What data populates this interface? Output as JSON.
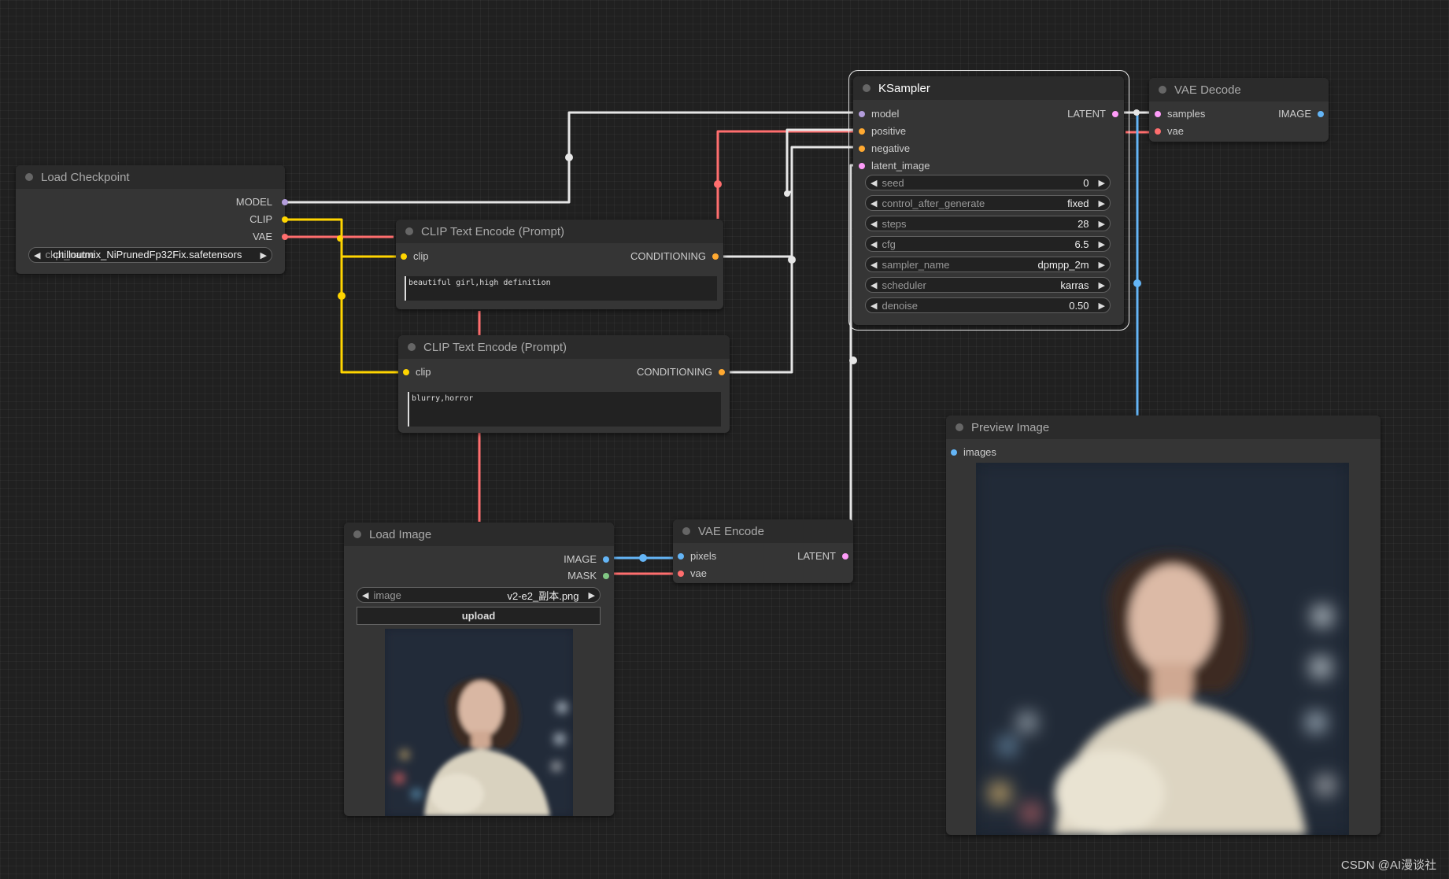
{
  "nodes": {
    "load_checkpoint": {
      "title": "Load Checkpoint",
      "outputs": [
        "MODEL",
        "CLIP",
        "VAE"
      ],
      "ckpt_name_label": "ckpt_name",
      "ckpt_name_value": "chilloutmix_NiPrunedFp32Fix.safetensors"
    },
    "clip_pos": {
      "title": "CLIP Text Encode (Prompt)",
      "input": "clip",
      "output": "CONDITIONING",
      "text": "beautiful girl,high definition"
    },
    "clip_neg": {
      "title": "CLIP Text Encode (Prompt)",
      "input": "clip",
      "output": "CONDITIONING",
      "text": "blurry,horror"
    },
    "ksampler": {
      "title": "KSampler",
      "inputs": [
        "model",
        "positive",
        "negative",
        "latent_image"
      ],
      "output": "LATENT",
      "widgets": [
        {
          "label": "seed",
          "value": "0"
        },
        {
          "label": "control_after_generate",
          "value": "fixed"
        },
        {
          "label": "steps",
          "value": "28"
        },
        {
          "label": "cfg",
          "value": "6.5"
        },
        {
          "label": "sampler_name",
          "value": "dpmpp_2m"
        },
        {
          "label": "scheduler",
          "value": "karras"
        },
        {
          "label": "denoise",
          "value": "0.50"
        }
      ]
    },
    "vae_decode": {
      "title": "VAE Decode",
      "inputs": [
        "samples",
        "vae"
      ],
      "output": "IMAGE"
    },
    "load_image": {
      "title": "Load Image",
      "outputs": [
        "IMAGE",
        "MASK"
      ],
      "image_label": "image",
      "image_value": "v2-e2_副本.png",
      "upload_label": "upload"
    },
    "vae_encode": {
      "title": "VAE Encode",
      "inputs": [
        "pixels",
        "vae"
      ],
      "output": "LATENT"
    },
    "preview_image": {
      "title": "Preview Image",
      "input": "images"
    }
  },
  "colors": {
    "model": "#b39ddb",
    "clip": "#ffd500",
    "vae": "#ff6e6e",
    "conditioning": "#ffa931",
    "latent": "#ff9cf9",
    "image": "#64b5f6",
    "mask": "#81c784",
    "wire_white": "#e6e6e6"
  },
  "watermark": "CSDN @AI漫谈社"
}
